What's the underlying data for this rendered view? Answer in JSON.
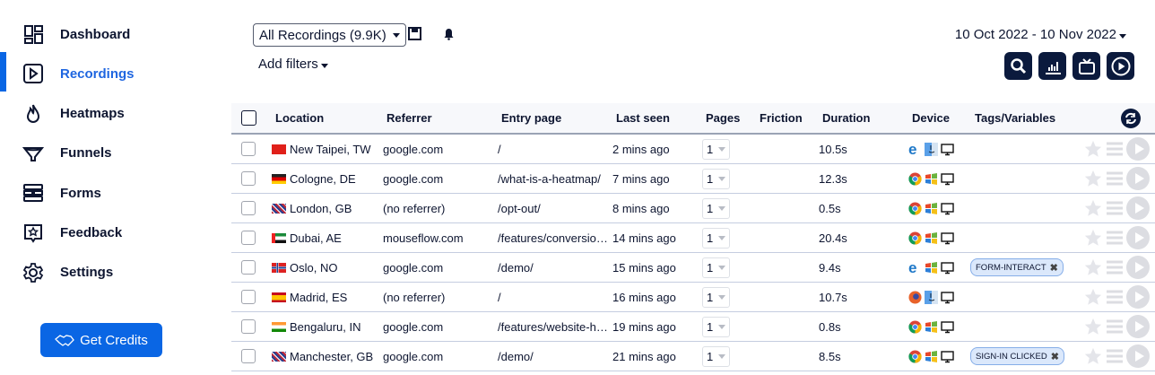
{
  "sidebar": {
    "items": [
      {
        "label": "Dashboard",
        "icon": "dashboard-icon"
      },
      {
        "label": "Recordings",
        "icon": "play-square-icon",
        "active": true
      },
      {
        "label": "Heatmaps",
        "icon": "flame-icon"
      },
      {
        "label": "Funnels",
        "icon": "funnel-icon"
      },
      {
        "label": "Forms",
        "icon": "forms-icon"
      },
      {
        "label": "Feedback",
        "icon": "feedback-star-icon"
      },
      {
        "label": "Settings",
        "icon": "gear-icon"
      }
    ],
    "credits_label": "Get Credits"
  },
  "toolbar": {
    "segment": "All Recordings (9.9K)",
    "add_filters": "Add filters",
    "date_range": "10 Oct 2022 - 10 Nov 2022"
  },
  "colors": {
    "accent": "#0a66e4",
    "dark": "#0b1a3d",
    "tag_bg": "#dbe8fb"
  },
  "table": {
    "columns": [
      "Location",
      "Referrer",
      "Entry page",
      "Last seen",
      "Pages",
      "Friction",
      "Duration",
      "Device",
      "Tags/Variables"
    ],
    "rows": [
      {
        "flag": "TW",
        "location": "New Taipei, TW",
        "referrer": "google.com",
        "entry": "/",
        "last_seen": "2 mins ago",
        "pages": "1",
        "duration": "10.5s",
        "browser": "edge",
        "os": "mac",
        "tag": ""
      },
      {
        "flag": "DE",
        "location": "Cologne, DE",
        "referrer": "google.com",
        "entry": "/what-is-a-heatmap/",
        "last_seen": "7 mins ago",
        "pages": "1",
        "duration": "12.3s",
        "browser": "chrome",
        "os": "windows",
        "tag": ""
      },
      {
        "flag": "GB",
        "location": "London, GB",
        "referrer": "(no referrer)",
        "entry": "/opt-out/",
        "last_seen": "8 mins ago",
        "pages": "1",
        "duration": "0.5s",
        "browser": "chrome",
        "os": "windows",
        "tag": ""
      },
      {
        "flag": "AE",
        "location": "Dubai, AE",
        "referrer": "mouseflow.com",
        "entry": "/features/conversio…",
        "last_seen": "14 mins ago",
        "pages": "1",
        "duration": "20.4s",
        "browser": "chrome",
        "os": "windows",
        "tag": ""
      },
      {
        "flag": "NO",
        "location": "Oslo, NO",
        "referrer": "google.com",
        "entry": "/demo/",
        "last_seen": "15 mins ago",
        "pages": "1",
        "duration": "9.4s",
        "browser": "edge",
        "os": "windows",
        "tag": "FORM-INTERACT"
      },
      {
        "flag": "ES",
        "location": "Madrid, ES",
        "referrer": "(no referrer)",
        "entry": "/",
        "last_seen": "16 mins ago",
        "pages": "1",
        "duration": "10.7s",
        "browser": "firefox",
        "os": "mac",
        "tag": ""
      },
      {
        "flag": "IN",
        "location": "Bengaluru, IN",
        "referrer": "google.com",
        "entry": "/features/website-h…",
        "last_seen": "19 mins ago",
        "pages": "1",
        "duration": "0.8s",
        "browser": "chrome",
        "os": "windows",
        "tag": ""
      },
      {
        "flag": "GB",
        "location": "Manchester, GB",
        "referrer": "google.com",
        "entry": "/demo/",
        "last_seen": "21 mins ago",
        "pages": "1",
        "duration": "8.5s",
        "browser": "chrome",
        "os": "windows",
        "tag": "SIGN-IN CLICKED"
      }
    ]
  }
}
